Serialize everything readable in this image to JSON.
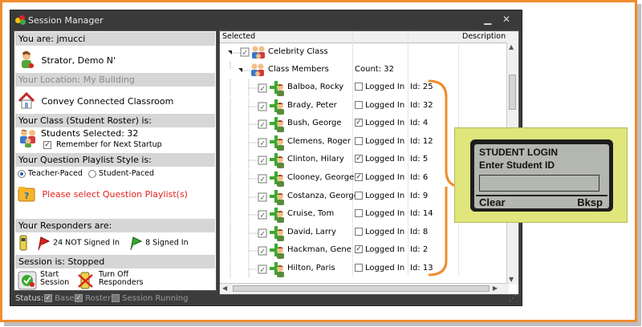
{
  "window": {
    "title": "Session Manager"
  },
  "left": {
    "you_are": "You are: jmucci",
    "user_name": "Strator, Demo N'",
    "location": "Your Location: My Building",
    "classroom": "Convey Connected Classroom",
    "class_header": "Your Class (Student  Roster) is:",
    "students_selected": "Students Selected: 32",
    "remember": "Remember for Next Startup",
    "playlist_header": "Your Question Playlist Style is:",
    "teacher_paced": "Teacher-Paced",
    "student_paced": "Student-Paced",
    "playlist_warning": "Please select Question Playlist(s)",
    "responders_header": "Your Responders are:",
    "not_signed": "24 NOT Signed In",
    "signed": "8 Signed In",
    "session_header": "Session is: Stopped",
    "start_line1": "Start",
    "start_line2": "Session",
    "turnoff_line1": "Turn Off",
    "turnoff_line2": "Responders"
  },
  "tree": {
    "col_selected": "Selected",
    "col_description": "Description",
    "root": "Celebrity Class",
    "members": "Class Members",
    "count": "Count: 32",
    "logged_label": "Logged In",
    "students": [
      {
        "name": "Balboa, Rocky",
        "id": "Id: 25",
        "logged": false
      },
      {
        "name": "Brady, Peter",
        "id": "Id: 32",
        "logged": false
      },
      {
        "name": "Bush, George",
        "id": "Id: 4",
        "logged": true
      },
      {
        "name": "Clemens, Roger",
        "id": "Id: 12",
        "logged": false
      },
      {
        "name": "Clinton, Hilary",
        "id": "Id: 5",
        "logged": true
      },
      {
        "name": "Clooney, George",
        "id": "Id: 6",
        "logged": true
      },
      {
        "name": "Costanza, George",
        "id": "Id: 9",
        "logged": false
      },
      {
        "name": "Cruise, Tom",
        "id": "Id: 14",
        "logged": false
      },
      {
        "name": "David, Larry",
        "id": "Id: 8",
        "logged": false
      },
      {
        "name": "Hackman, Gene",
        "id": "Id: 2",
        "logged": true
      },
      {
        "name": "Hilton, Paris",
        "id": "Id: 13",
        "logged": false
      }
    ]
  },
  "status": {
    "label": "Status:",
    "base": "Base",
    "roster": "Roster",
    "session_running": "Session Running"
  },
  "device": {
    "line1": "STUDENT LOGIN",
    "line2": "Enter Student ID",
    "clear": "Clear",
    "bksp": "Bksp"
  },
  "colors": {
    "accent": "#f08c2e",
    "warning": "#e2211c",
    "device_bg": "#e0e67b"
  }
}
